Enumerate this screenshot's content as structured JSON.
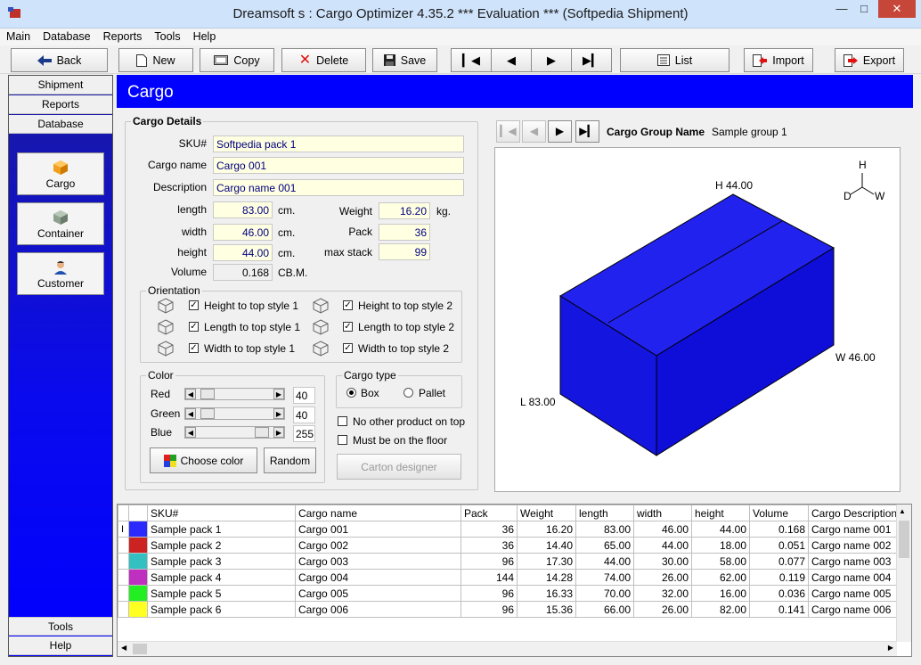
{
  "window": {
    "title": "Dreamsoft s : Cargo Optimizer 4.35.2 *** Evaluation *** (Softpedia Shipment)"
  },
  "menu": [
    "Main",
    "Database",
    "Reports",
    "Tools",
    "Help"
  ],
  "toolbar": {
    "back": "Back",
    "new": "New",
    "copy": "Copy",
    "delete": "Delete",
    "save": "Save",
    "list": "List",
    "import": "Import",
    "export": "Export"
  },
  "sidebar": {
    "tabs_top": [
      "Shipment",
      "Reports",
      "Database"
    ],
    "items": [
      "Cargo",
      "Container",
      "Customer"
    ],
    "tabs_bottom": [
      "Tools",
      "Help"
    ]
  },
  "header": {
    "title": "Cargo"
  },
  "details": {
    "legend": "Cargo Details",
    "sku_label": "SKU#",
    "sku": "Softpedia pack 1",
    "name_label": "Cargo name",
    "name": "Cargo 001",
    "desc_label": "Description",
    "desc": "Cargo name 001",
    "length_label": "length",
    "length": "83.00",
    "width_label": "width",
    "width": "46.00",
    "height_label": "height",
    "height": "44.00",
    "volume_label": "Volume",
    "volume": "0.168",
    "unit_cm": "cm.",
    "unit_cbm": "CB.M.",
    "weight_label": "Weight",
    "weight": "16.20",
    "unit_kg": "kg.",
    "pack_label": "Pack",
    "pack": "36",
    "maxstack_label": "max stack",
    "maxstack": "99"
  },
  "orientation": {
    "legend": "Orientation",
    "options": [
      "Height to top style 1",
      "Height to top style 2",
      "Length to top style 1",
      "Length to top style 2",
      "Width to top style 1",
      "Width to top style 2"
    ]
  },
  "color": {
    "legend": "Color",
    "red_label": "Red",
    "red": "40",
    "green_label": "Green",
    "green": "40",
    "blue_label": "Blue",
    "blue": "255",
    "choose": "Choose color",
    "random": "Random"
  },
  "cargo_type": {
    "legend": "Cargo type",
    "box": "Box",
    "pallet": "Pallet"
  },
  "flags": {
    "no_other": "No other product on top",
    "floor": "Must be on the floor"
  },
  "carton_designer": "Carton designer",
  "group": {
    "label": "Cargo Group Name",
    "value": "Sample group 1"
  },
  "preview": {
    "h": "H 44.00",
    "w": "W 46.00",
    "l": "L 83.00",
    "axis_h": "H",
    "axis_d": "D",
    "axis_w": "W"
  },
  "grid": {
    "columns": [
      "SKU#",
      "Cargo name",
      "Pack",
      "Weight",
      "length",
      "width",
      "height",
      "Volume",
      "Cargo Description"
    ],
    "rows": [
      {
        "color": "#2a2aff",
        "sku": "Sample pack 1",
        "name": "Cargo 001",
        "pack": "36",
        "weight": "16.20",
        "length": "83.00",
        "width": "46.00",
        "height": "44.00",
        "volume": "0.168",
        "desc": "Cargo name 001"
      },
      {
        "color": "#cc2222",
        "sku": "Sample pack 2",
        "name": "Cargo 002",
        "pack": "36",
        "weight": "14.40",
        "length": "65.00",
        "width": "44.00",
        "height": "18.00",
        "volume": "0.051",
        "desc": "Cargo name 002"
      },
      {
        "color": "#33c0c0",
        "sku": "Sample pack 3",
        "name": "Cargo 003",
        "pack": "96",
        "weight": "17.30",
        "length": "44.00",
        "width": "30.00",
        "height": "58.00",
        "volume": "0.077",
        "desc": "Cargo name 003"
      },
      {
        "color": "#c030c0",
        "sku": "Sample pack 4",
        "name": "Cargo 004",
        "pack": "144",
        "weight": "14.28",
        "length": "74.00",
        "width": "26.00",
        "height": "62.00",
        "volume": "0.119",
        "desc": "Cargo name 004"
      },
      {
        "color": "#22ee22",
        "sku": "Sample pack 5",
        "name": "Cargo 005",
        "pack": "96",
        "weight": "16.33",
        "length": "70.00",
        "width": "32.00",
        "height": "16.00",
        "volume": "0.036",
        "desc": "Cargo name 005"
      },
      {
        "color": "#ffff22",
        "sku": "Sample pack 6",
        "name": "Cargo 006",
        "pack": "96",
        "weight": "15.36",
        "length": "66.00",
        "width": "26.00",
        "height": "82.00",
        "volume": "0.141",
        "desc": "Cargo name 006"
      }
    ]
  },
  "colors": {
    "accent": "#0000ff",
    "input_bg": "#ffffe1"
  }
}
